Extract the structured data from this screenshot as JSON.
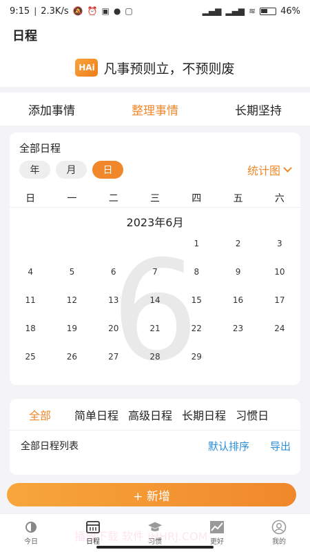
{
  "status_bar": {
    "time": "9:15",
    "speed": "2.3K/s",
    "battery_percent": "46%",
    "icons": [
      "mute-icon",
      "alarm-icon",
      "nfc-icon",
      "notification-icon",
      "app-icon",
      "signal-icon",
      "wifi-icon",
      "battery-icon"
    ]
  },
  "header": {
    "title": "日程"
  },
  "motto": {
    "logo_text": "HAi",
    "text": "凡事预则立，不预则废"
  },
  "top_tabs": [
    {
      "label": "添加事情",
      "active": false
    },
    {
      "label": "整理事情",
      "active": true
    },
    {
      "label": "长期坚持",
      "active": false
    }
  ],
  "calendar": {
    "title": "全部日程",
    "segments": [
      {
        "label": "年",
        "active": false
      },
      {
        "label": "月",
        "active": false
      },
      {
        "label": "日",
        "active": true
      }
    ],
    "stats_label": "统计图",
    "weekdays": [
      "日",
      "一",
      "二",
      "三",
      "四",
      "五",
      "六"
    ],
    "month_title": "2023年6月",
    "big_month": "6",
    "days": [
      "",
      "",
      "",
      "",
      "1",
      "2",
      "3",
      "4",
      "5",
      "6",
      "7",
      "8",
      "9",
      "10",
      "11",
      "12",
      "13",
      "14",
      "15",
      "16",
      "17",
      "18",
      "19",
      "20",
      "21",
      "22",
      "23",
      "24",
      "25",
      "26",
      "27",
      "28",
      "29",
      "",
      ""
    ]
  },
  "categories": {
    "tabs": [
      {
        "label": "全部",
        "active": true
      },
      {
        "label": "简单日程",
        "active": false
      },
      {
        "label": "高级日程",
        "active": false
      },
      {
        "label": "长期日程",
        "active": false
      },
      {
        "label": "习惯日",
        "active": false
      }
    ],
    "list_title": "全部日程列表",
    "sort_label": "默认排序",
    "export_label": "导出"
  },
  "add_button": {
    "label": "+ 新增"
  },
  "bottom_nav": [
    {
      "label": "今日",
      "icon": "today-icon",
      "active": false
    },
    {
      "label": "日程",
      "icon": "calendar-icon",
      "active": true
    },
    {
      "label": "习惯",
      "icon": "graduation-cap-icon",
      "active": false
    },
    {
      "label": "更好",
      "icon": "trend-chart-icon",
      "active": false
    },
    {
      "label": "我的",
      "icon": "profile-icon",
      "active": false
    }
  ],
  "watermark": "播放下载 软件 JHHRJ.COM",
  "colors": {
    "accent": "#f0882b",
    "link": "#2a8fd8",
    "background": "#f4f4f6"
  }
}
